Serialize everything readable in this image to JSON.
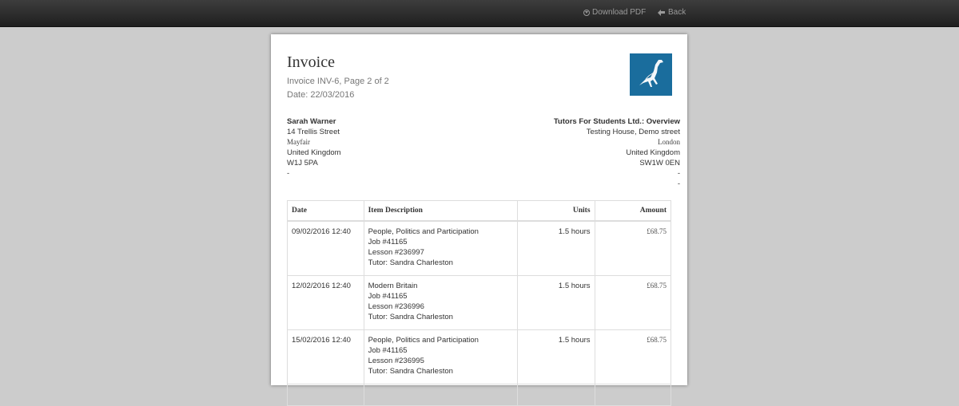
{
  "toolbar": {
    "download_label": "Download PDF",
    "back_label": "Back",
    "download_icon": "download-icon",
    "back_icon": "arrow-left-icon"
  },
  "invoice": {
    "title": "Invoice",
    "subtitle": "Invoice INV-6, Page 2 of 2",
    "date": "Date: 22/03/2016",
    "logo": "dinosaur-logo",
    "brand_color": "#1a6d9d"
  },
  "bill_to": {
    "name": "Sarah Warner",
    "street": "14 Trellis Street",
    "area": "Mayfair",
    "country": "United Kingdom",
    "postcode": "W1J 5PA",
    "extra": "-"
  },
  "from": {
    "name": "Tutors For Students Ltd.: Overview",
    "street": "Testing House, Demo street",
    "city": "London",
    "country": "United Kingdom",
    "postcode": "SW1W 0EN",
    "extra1": "-",
    "extra2": "-"
  },
  "table": {
    "headers": {
      "date": "Date",
      "description": "Item Description",
      "units": "Units",
      "amount": "Amount"
    },
    "rows": [
      {
        "date": "09/02/2016 12:40",
        "title": "People, Politics and Participation",
        "job": "Job #41165",
        "lesson": "Lesson #236997",
        "tutor": "Tutor: Sandra Charleston",
        "units": "1.5 hours",
        "amount": "£68.75"
      },
      {
        "date": "12/02/2016 12:40",
        "title": "Modern Britain",
        "job": "Job #41165",
        "lesson": "Lesson #236996",
        "tutor": "Tutor: Sandra Charleston",
        "units": "1.5 hours",
        "amount": "£68.75"
      },
      {
        "date": "15/02/2016 12:40",
        "title": "People, Politics and Participation",
        "job": "Job #41165",
        "lesson": "Lesson #236995",
        "tutor": "Tutor: Sandra Charleston",
        "units": "1.5 hours",
        "amount": "£68.75"
      }
    ]
  }
}
